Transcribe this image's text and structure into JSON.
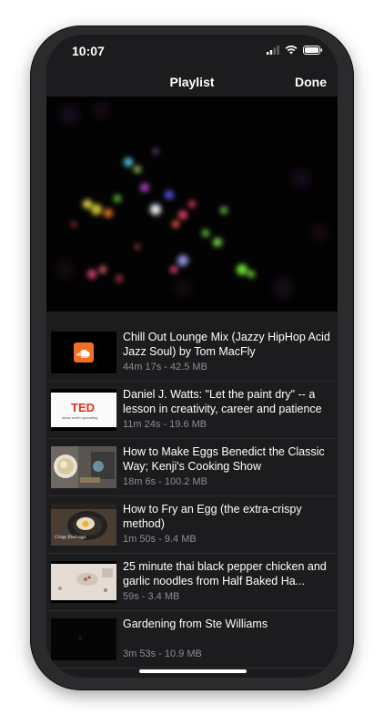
{
  "status_bar": {
    "time": "10:07"
  },
  "nav": {
    "title": "Playlist",
    "done": "Done"
  },
  "playlist": [
    {
      "title": "Chill Out Lounge Mix (Jazzy HipHop Acid Jazz Soul) by Tom MacFly",
      "meta": "44m 17s - 42.5 MB",
      "thumb": "soundcloud-logo"
    },
    {
      "title": "Daniel J. Watts: \"Let the paint dry\" -- a lesson in creativity, career and patience",
      "meta": "11m 24s - 19.6 MB",
      "thumb": "ted-logo",
      "thumb_text": "TED",
      "thumb_subtext": "Ideas worth spreading"
    },
    {
      "title": "How to Make Eggs Benedict the Classic Way; Kenji's Cooking Show",
      "meta": "18m 6s - 100.2 MB",
      "thumb": "eggs-benedict-photo"
    },
    {
      "title": "How to Fry an Egg (the extra-crispy method)",
      "meta": "1m 50s - 9.4 MB",
      "thumb": "fried-egg-photo",
      "thumb_text": "Crispy fried eggs"
    },
    {
      "title": "25 minute thai black pepper chicken and garlic noodles from Half Baked Ha...",
      "meta": "59s - 3.4 MB",
      "thumb": "noodles-photo"
    },
    {
      "title": "Gardening from Ste Williams",
      "meta": "3m 53s - 10.9 MB",
      "thumb": "dark-thumbnail"
    }
  ],
  "colors": {
    "background": "#1c1c1e",
    "soundcloud": "#f26f23",
    "ted": "#e62b1e"
  }
}
